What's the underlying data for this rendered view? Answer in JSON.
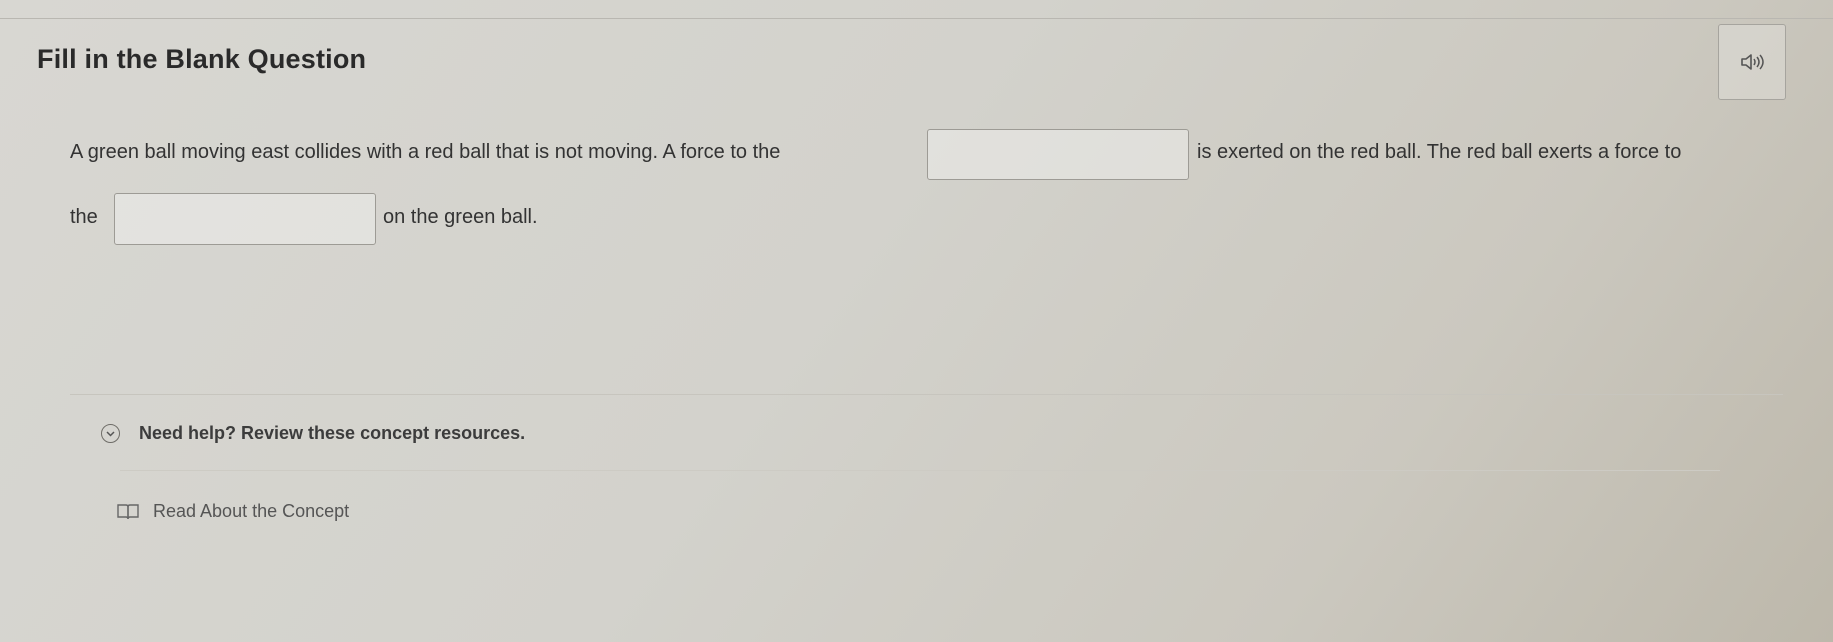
{
  "header": {
    "title": "Fill in the Blank Question",
    "audio_icon": "speaker-icon"
  },
  "question": {
    "line1_before": "A green ball moving east collides with a red ball that is not moving. A force to the",
    "blank1_value": "",
    "line1_after": "is exerted on the red ball. The red ball exerts a force to",
    "line2_before": "the",
    "blank2_value": "",
    "line2_after": "on the green ball."
  },
  "help": {
    "toggle_icon": "chevron-down-icon",
    "label": "Need help? Review these concept resources.",
    "resources": [
      {
        "icon": "book-icon",
        "label": "Read About the Concept"
      }
    ]
  }
}
